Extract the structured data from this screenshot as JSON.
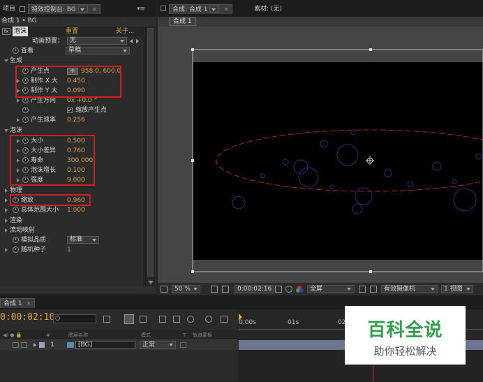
{
  "left_panel": {
    "tabs": [
      {
        "label": "项目"
      },
      {
        "label": "特效控制台: BG",
        "close": "×"
      }
    ],
    "menu_glyph": "▾≡",
    "subtitle": "合成 1 • BG",
    "effect": {
      "fx": "fx",
      "name": "泡沫",
      "reset": "重置",
      "about": "关于..."
    },
    "preset": {
      "label": "动画预置：",
      "value": "无"
    },
    "view": {
      "label": "查看",
      "value": "草稿"
    },
    "sections": {
      "producer": "生成",
      "bubbles": "泡沫",
      "physics": "物理",
      "rendering": "渲染",
      "flow_map": "流动映射"
    },
    "properties": {
      "producer_point": {
        "label": "产生点",
        "value": "958.0, 600.0"
      },
      "producer_x_size": {
        "label": "制作 X 大",
        "value": "0.450"
      },
      "producer_y_size": {
        "label": "制作 Y 大",
        "value": "0.090"
      },
      "producer_orientation": {
        "label": "产生方向",
        "value": "0x +0.0 °"
      },
      "zoom_producer": {
        "label": "缩放产生点",
        "checked": true
      },
      "production_rate": {
        "label": "产生速率",
        "value": "0.256"
      },
      "size": {
        "label": "大小",
        "value": "0.500"
      },
      "size_variance": {
        "label": "大小差异",
        "value": "0.760"
      },
      "lifespan": {
        "label": "寿命",
        "value": "300.000"
      },
      "growth_speed": {
        "label": "泡沫增长",
        "value": "0.100"
      },
      "strength": {
        "label": "强度",
        "value": "9.000"
      },
      "zoom": {
        "label": "缩放",
        "value": "0.960"
      },
      "universe_size": {
        "label": "总体范围大小",
        "value": "1.000"
      },
      "sim_quality": {
        "label": "模拟品质",
        "value": "标准"
      },
      "random_seed": {
        "label": "随机种子",
        "value": "1"
      }
    }
  },
  "comp_panel": {
    "tabs": [
      {
        "label": "合成: 合成 1"
      },
      {
        "label": "素材: (无)"
      }
    ],
    "breadcrumb": "合成 1",
    "toolbar": {
      "zoom": "50 %",
      "timecode": "0:00:02:16",
      "resolution": "全屏",
      "camera": "有效摄像机",
      "views": "1 视图"
    },
    "colors": {
      "canvas_bg": "#000000",
      "pasteboard": "#454545",
      "bubble_stroke": "#2b2f7a",
      "producer_ellipse": "#b8212a"
    }
  },
  "timeline": {
    "tab": "合成 1",
    "close": "×",
    "current_time": "0:00:02:16",
    "ruler": [
      "0:00s",
      "01s",
      "02s"
    ],
    "headers": {
      "source_name": "图层名称",
      "mode": "模式",
      "t": "T",
      "trkmat": "轨道蒙板",
      "num": "#"
    },
    "layer": {
      "number": "1",
      "name": "[BG]",
      "mode": "正常"
    }
  },
  "watermark": {
    "title": "百科全说",
    "subtitle": "助你轻松解决",
    "color": "#2fa14b"
  }
}
